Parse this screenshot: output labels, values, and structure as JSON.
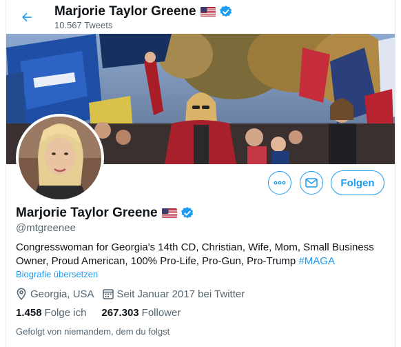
{
  "header": {
    "name": "Marjorie Taylor Greene",
    "tweet_count": "10.567 Tweets"
  },
  "profile": {
    "name": "Marjorie Taylor Greene",
    "handle": "@mtgreenee",
    "bio_text": "Congresswoman for Georgia's 14th CD, Christian, Wife, Mom, Small Business Owner, Proud American, 100% Pro-Life, Pro-Gun, Pro-Trump ",
    "bio_hashtag": "#MAGA",
    "translate_link": "Biografie übersetzen",
    "location": "Georgia, USA",
    "joined": "Seit Januar 2017 bei Twitter",
    "following_count": "1.458",
    "following_label": "Folge ich",
    "followers_count": "267.303",
    "followers_label": "Follower",
    "followed_by": "Gefolgt von niemandem, dem du folgst"
  },
  "actions": {
    "follow_label": "Folgen",
    "more_icon": "more-icon",
    "message_icon": "mail-icon"
  },
  "colors": {
    "accent": "#1d9bf0",
    "secondary_text": "#536471"
  }
}
